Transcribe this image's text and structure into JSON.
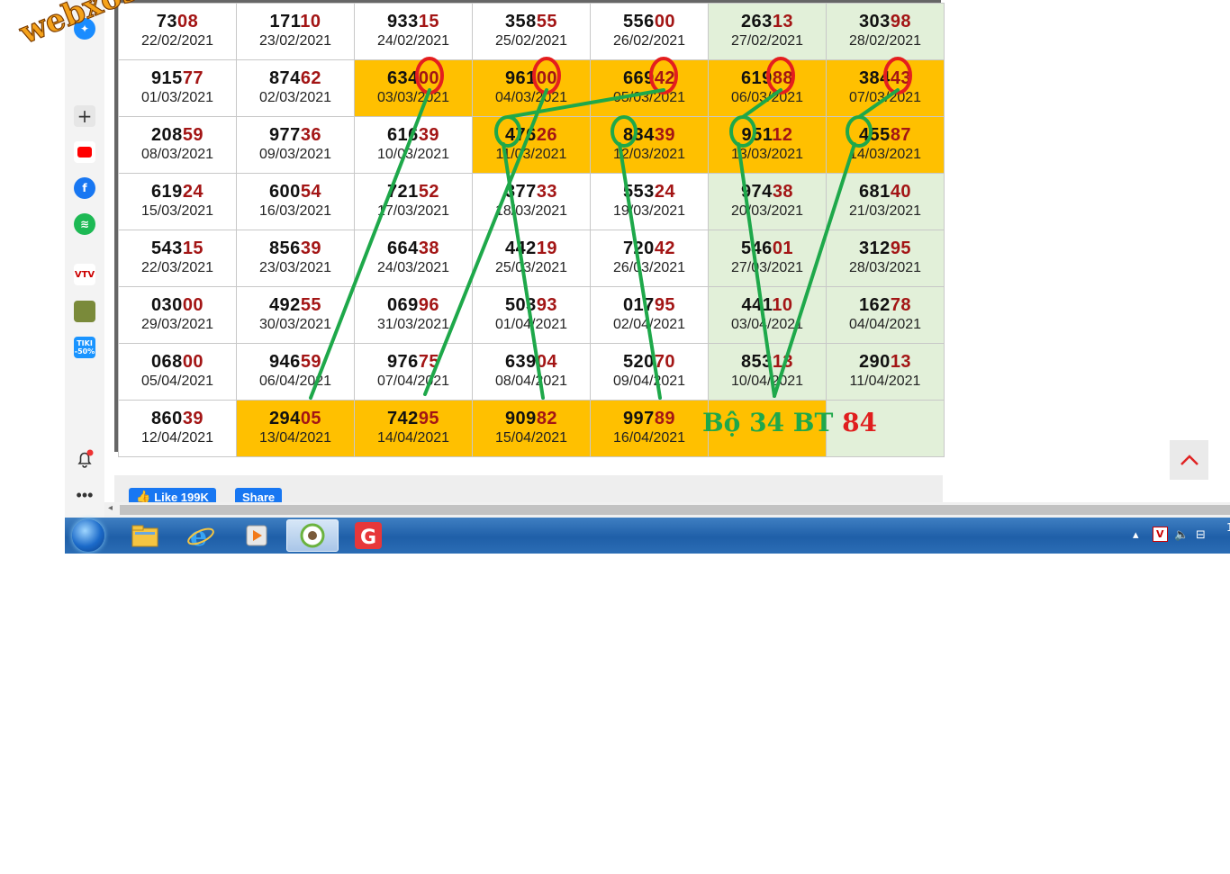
{
  "watermark": "webxoso.net",
  "sidebar": {
    "icons": [
      "messenger-icon",
      "add-icon",
      "youtube-icon",
      "facebook-icon",
      "spotify-icon",
      "vtv-go-icon",
      "game-icon",
      "tiki-icon",
      "notification-bell-icon",
      "more-icon"
    ],
    "tiki_label": "TIKI",
    "tiki_discount": "-50%"
  },
  "table": {
    "rows": [
      [
        {
          "first": "73",
          "last": "08",
          "date": "22/02/2021"
        },
        {
          "first": "171",
          "last": "10",
          "date": "23/02/2021"
        },
        {
          "first": "933",
          "last": "15",
          "date": "24/02/2021"
        },
        {
          "first": "358",
          "last": "55",
          "date": "25/02/2021"
        },
        {
          "first": "556",
          "last": "00",
          "date": "26/02/2021"
        },
        {
          "first": "263",
          "last": "13",
          "date": "27/02/2021"
        },
        {
          "first": "303",
          "last": "98",
          "date": "28/02/2021"
        }
      ],
      [
        {
          "first": "915",
          "last": "77",
          "date": "01/03/2021"
        },
        {
          "first": "874",
          "last": "62",
          "date": "02/03/2021"
        },
        {
          "first": "634",
          "last": "00",
          "date": "03/03/2021"
        },
        {
          "first": "961",
          "last": "00",
          "date": "04/03/2021"
        },
        {
          "first": "669",
          "last": "42",
          "date": "05/03/2021"
        },
        {
          "first": "619",
          "last": "88",
          "date": "06/03/2021"
        },
        {
          "first": "384",
          "last": "43",
          "date": "07/03/2021"
        }
      ],
      [
        {
          "first": "208",
          "last": "59",
          "date": "08/03/2021"
        },
        {
          "first": "977",
          "last": "36",
          "date": "09/03/2021"
        },
        {
          "first": "616",
          "last": "39",
          "date": "10/03/2021"
        },
        {
          "first": "476",
          "last": "26",
          "date": "11/03/2021"
        },
        {
          "first": "834",
          "last": "39",
          "date": "12/03/2021"
        },
        {
          "first": "951",
          "last": "12",
          "date": "13/03/2021"
        },
        {
          "first": "455",
          "last": "87",
          "date": "14/03/2021"
        }
      ],
      [
        {
          "first": "619",
          "last": "24",
          "date": "15/03/2021"
        },
        {
          "first": "600",
          "last": "54",
          "date": "16/03/2021"
        },
        {
          "first": "721",
          "last": "52",
          "date": "17/03/2021"
        },
        {
          "first": "377",
          "last": "33",
          "date": "18/03/2021"
        },
        {
          "first": "553",
          "last": "24",
          "date": "19/03/2021"
        },
        {
          "first": "974",
          "last": "38",
          "date": "20/03/2021"
        },
        {
          "first": "681",
          "last": "40",
          "date": "21/03/2021"
        }
      ],
      [
        {
          "first": "543",
          "last": "15",
          "date": "22/03/2021"
        },
        {
          "first": "856",
          "last": "39",
          "date": "23/03/2021"
        },
        {
          "first": "664",
          "last": "38",
          "date": "24/03/2021"
        },
        {
          "first": "442",
          "last": "19",
          "date": "25/03/2021"
        },
        {
          "first": "720",
          "last": "42",
          "date": "26/03/2021"
        },
        {
          "first": "546",
          "last": "01",
          "date": "27/03/2021"
        },
        {
          "first": "312",
          "last": "95",
          "date": "28/03/2021"
        }
      ],
      [
        {
          "first": "030",
          "last": "00",
          "date": "29/03/2021"
        },
        {
          "first": "492",
          "last": "55",
          "date": "30/03/2021"
        },
        {
          "first": "069",
          "last": "96",
          "date": "31/03/2021"
        },
        {
          "first": "503",
          "last": "93",
          "date": "01/04/2021"
        },
        {
          "first": "017",
          "last": "95",
          "date": "02/04/2021"
        },
        {
          "first": "441",
          "last": "10",
          "date": "03/04/2021"
        },
        {
          "first": "162",
          "last": "78",
          "date": "04/04/2021"
        }
      ],
      [
        {
          "first": "068",
          "last": "00",
          "date": "05/04/2021"
        },
        {
          "first": "946",
          "last": "59",
          "date": "06/04/2021"
        },
        {
          "first": "976",
          "last": "75",
          "date": "07/04/2021"
        },
        {
          "first": "639",
          "last": "04",
          "date": "08/04/2021"
        },
        {
          "first": "520",
          "last": "70",
          "date": "09/04/2021"
        },
        {
          "first": "853",
          "last": "13",
          "date": "10/04/2021"
        },
        {
          "first": "290",
          "last": "13",
          "date": "11/04/2021"
        }
      ],
      [
        {
          "first": "860",
          "last": "39",
          "date": "12/04/2021"
        },
        {
          "first": "294",
          "last": "05",
          "date": "13/04/2021"
        },
        {
          "first": "742",
          "last": "95",
          "date": "14/04/2021"
        },
        {
          "first": "909",
          "last": "82",
          "date": "15/04/2021"
        },
        {
          "first": "997",
          "last": "89",
          "date": "16/04/2021"
        },
        null,
        null
      ]
    ]
  },
  "note": {
    "green": "Bộ 34 BT",
    "red": "84"
  },
  "fb": {
    "like_label": "Like 199K",
    "share_label": "Share"
  },
  "taskbar": {
    "apps": [
      "file-explorer-icon",
      "internet-explorer-icon",
      "media-player-icon",
      "coccoc-browser-icon",
      "garena-icon"
    ],
    "tray": [
      "show-hidden-icons",
      "v-icon",
      "volume-icon",
      "network-icon"
    ],
    "clock_partial": "1"
  },
  "colors": {
    "highlight": "#ffc000",
    "weekend": "#e2f0d9",
    "last_digits": "#a31515",
    "mark_red": "#e41e1e",
    "mark_green": "#1ea84a"
  }
}
